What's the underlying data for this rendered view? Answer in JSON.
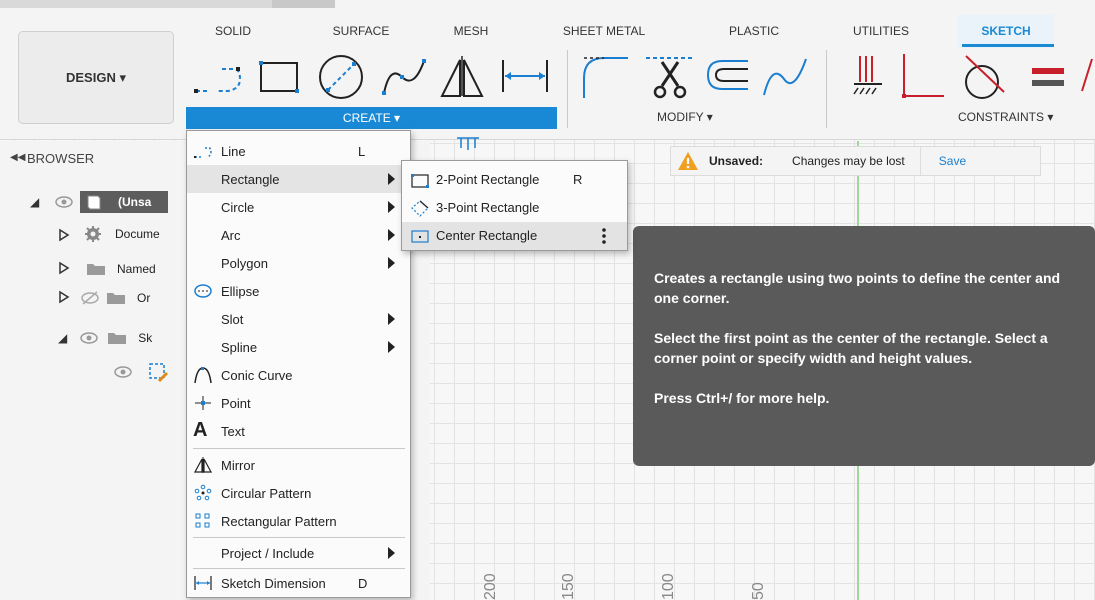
{
  "toolbar": {
    "design_label": "DESIGN ▾",
    "tabs": [
      "SOLID",
      "SURFACE",
      "MESH",
      "SHEET METAL",
      "PLASTIC",
      "UTILITIES",
      "SKETCH"
    ],
    "active_tab": "SKETCH",
    "create_label": "CREATE ▾",
    "modify_label": "MODIFY ▾",
    "constraints_label": "CONSTRAINTS ▾",
    "accent_color": "#1989d6"
  },
  "browser": {
    "title": "BROWSER",
    "rows": [
      {
        "label": "(Unsa",
        "icon": "component-icon"
      },
      {
        "label": "Docume",
        "icon": "gear-icon"
      },
      {
        "label": "Named",
        "icon": "folder-icon"
      },
      {
        "label": "Or",
        "icon": "folder-icon"
      },
      {
        "label": "Sk",
        "icon": "folder-icon"
      }
    ]
  },
  "notice": {
    "unsaved_label": "Unsaved:",
    "message": "Changes may be lost",
    "save_label": "Save"
  },
  "create_menu": {
    "items": [
      {
        "label": "Line",
        "shortcut": "L",
        "icon": "line-icon"
      },
      {
        "label": "Rectangle",
        "submenu": true
      },
      {
        "label": "Circle",
        "submenu": true
      },
      {
        "label": "Arc",
        "submenu": true
      },
      {
        "label": "Polygon",
        "submenu": true
      },
      {
        "label": "Ellipse",
        "icon": "ellipse-icon"
      },
      {
        "label": "Slot",
        "submenu": true
      },
      {
        "label": "Spline",
        "submenu": true
      },
      {
        "label": "Conic Curve",
        "icon": "conic-curve-icon"
      },
      {
        "label": "Point",
        "icon": "point-icon"
      },
      {
        "label": "Text",
        "icon": "text-icon"
      },
      {
        "label": "Mirror",
        "icon": "mirror-icon"
      },
      {
        "label": "Circular Pattern",
        "icon": "circular-pattern-icon"
      },
      {
        "label": "Rectangular Pattern",
        "icon": "rectangular-pattern-icon"
      },
      {
        "label": "Project / Include",
        "submenu": true
      },
      {
        "label": "Sketch Dimension",
        "shortcut": "D",
        "icon": "sketch-dimension-icon"
      }
    ]
  },
  "rectangle_submenu": {
    "items": [
      {
        "label": "2-Point Rectangle",
        "shortcut": "R",
        "icon": "two-point-rectangle-icon"
      },
      {
        "label": "3-Point Rectangle",
        "icon": "three-point-rectangle-icon"
      },
      {
        "label": "Center Rectangle",
        "icon": "center-rectangle-icon",
        "highlighted": true
      }
    ]
  },
  "tooltip": {
    "line1": "Creates a rectangle using two points to define the center and one corner.",
    "line2": "Select the first point as the center of the rectangle. Select a corner point or specify width and height values.",
    "line3": "Press Ctrl+/ for more help."
  },
  "ruler": {
    "labels": [
      "200",
      "150",
      "100",
      "50"
    ]
  }
}
